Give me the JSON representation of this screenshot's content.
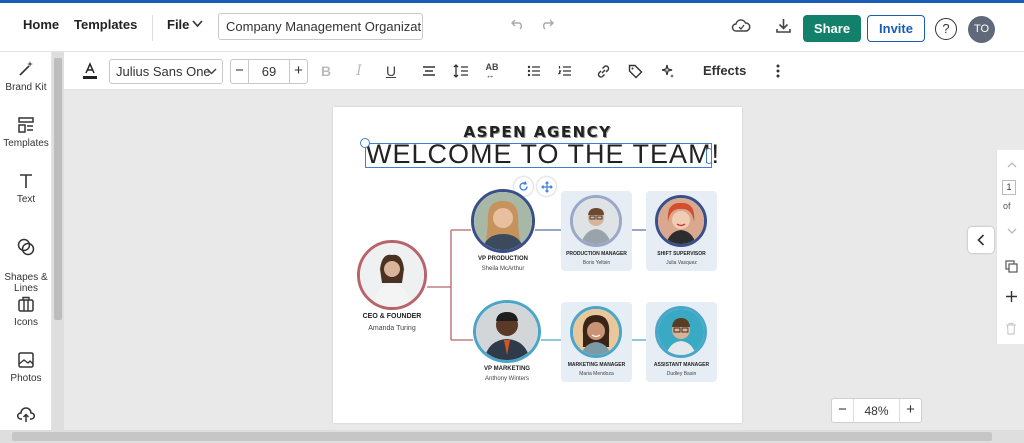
{
  "menu": {
    "home": "Home",
    "templates": "Templates",
    "file": "File",
    "doc_title": "Company Management Organizati...",
    "share": "Share",
    "invite": "Invite",
    "help": "?",
    "user_initials": "TO"
  },
  "sidebar": {
    "items": [
      {
        "label": "Brand Kit",
        "icon": "magic-wand-icon"
      },
      {
        "label": "Templates",
        "icon": "templates-icon"
      },
      {
        "label": "Text",
        "icon": "text-icon"
      },
      {
        "label": "Shapes &\nLines",
        "icon": "shapes-icon"
      },
      {
        "label": "Icons",
        "icon": "briefcase-icon"
      },
      {
        "label": "Photos",
        "icon": "image-icon"
      }
    ]
  },
  "toolbar": {
    "font": "Julius Sans One",
    "font_size": "69",
    "effects": "Effects"
  },
  "canvas": {
    "agency": "ASPEN AGENCY",
    "welcome": "WELCOME TO THE TEAM!",
    "people": [
      {
        "role": "CEO & FOUNDER",
        "name": "Amanda Turing"
      },
      {
        "role": "VP PRODUCTION",
        "name": "Sheila McArthur"
      },
      {
        "role": "PRODUCTION MANAGER",
        "name": "Boris Yeltsin"
      },
      {
        "role": "SHIFT SUPERVISOR",
        "name": "Julia Vasquez"
      },
      {
        "role": "VP MARKETING",
        "name": "Anthony Winters"
      },
      {
        "role": "MARKETING MANAGER",
        "name": "Maria Mendoza"
      },
      {
        "role": "ASSISTANT MANAGER",
        "name": "Dudley Basin"
      }
    ]
  },
  "right_panel": {
    "page_num": "1",
    "of": "of"
  },
  "zoom": {
    "value": "48%",
    "minus": "−",
    "plus": "+"
  },
  "colors": {
    "share": "#12806a",
    "accent": "#1a5db4",
    "ceo_ring": "#b8646a",
    "vp_ring": "#3a4f8a",
    "mkt_ring": "#4aa6c8"
  }
}
